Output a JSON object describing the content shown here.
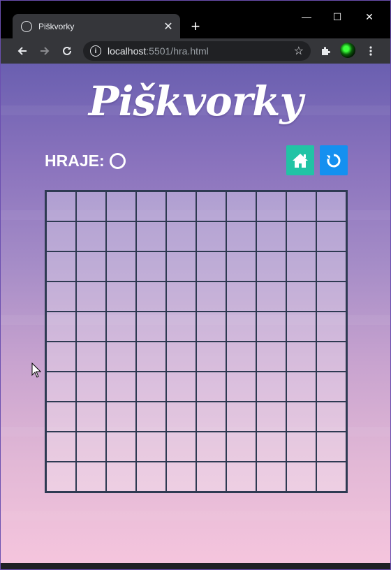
{
  "browser": {
    "tab_title": "Piškvorky",
    "tab_close": "✕",
    "new_tab": "+",
    "url_host": "localhost",
    "url_rest": ":5501/hra.html",
    "window_controls": {
      "minimize": "—",
      "maximize": "☐",
      "close": "✕"
    }
  },
  "page": {
    "title": "Piškvorky",
    "turn_label": "HRAJE:",
    "current_player": "O",
    "home_button_icon": "home-icon",
    "restart_button_icon": "restart-icon",
    "board": {
      "rows": 10,
      "columns": 10
    }
  },
  "colors": {
    "home_button": "#22c3a5",
    "restart_button": "#1490f0",
    "grid_line": "#2e3a52"
  }
}
